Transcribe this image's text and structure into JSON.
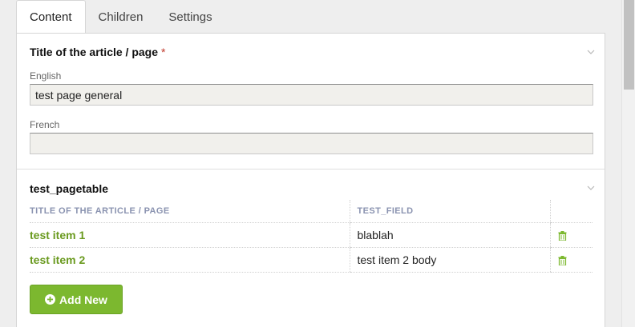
{
  "tabs": [
    {
      "label": "Content",
      "active": true
    },
    {
      "label": "Children",
      "active": false
    },
    {
      "label": "Settings",
      "active": false
    }
  ],
  "title_group": {
    "title": "Title of the article / page",
    "required_mark": "*",
    "collapse_icon": "chevron-down-icon",
    "fields": {
      "english": {
        "label": "English",
        "value": "test page general"
      },
      "french": {
        "label": "French",
        "value": ""
      }
    }
  },
  "pagetable_group": {
    "title": "test_pagetable",
    "collapse_icon": "chevron-down-icon",
    "columns": [
      "TITLE OF THE ARTICLE / PAGE",
      "TEST_FIELD"
    ],
    "rows": [
      {
        "title": "test item 1",
        "test_field": "blablah",
        "delete_icon": "trash-icon"
      },
      {
        "title": "test item 2",
        "test_field": "test item 2 body",
        "delete_icon": "trash-icon"
      }
    ],
    "add_button_label": "Add New",
    "add_button_icon": "plus-circle-icon"
  },
  "colors": {
    "accent_green": "#7cb82f",
    "link_green": "#6a9a1f",
    "header_blue_gray": "#8a93b0",
    "required_red": "#c0392b"
  }
}
